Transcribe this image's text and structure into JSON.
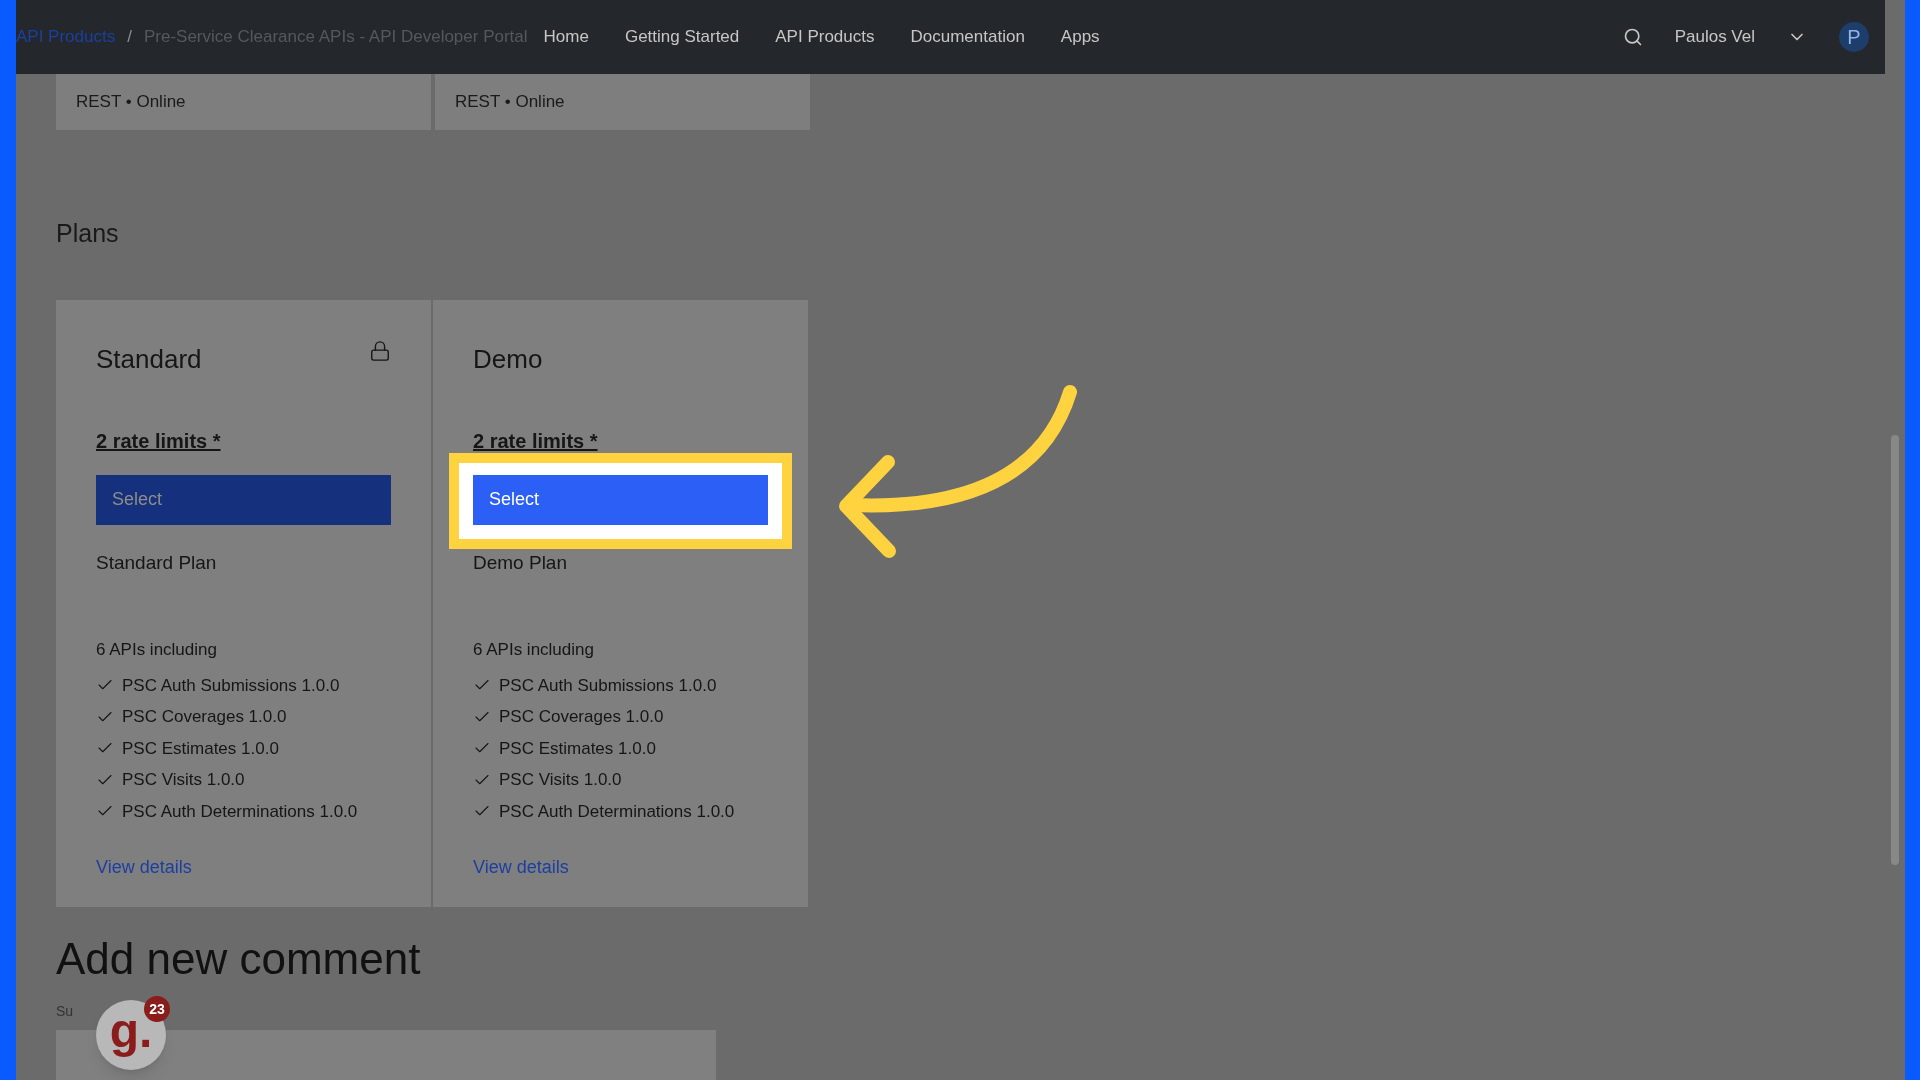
{
  "header": {
    "breadcrumb": [
      {
        "label": "API Products",
        "kind": "link"
      },
      {
        "label": "Pre-Service Clearance APIs - API Developer Portal",
        "kind": "current"
      }
    ],
    "separator": "/",
    "nav": [
      "Home",
      "Getting Started",
      "API Products",
      "Documentation",
      "Apps"
    ],
    "user": "Paulos Vel",
    "avatar": "P"
  },
  "api_cards": [
    "REST • Online",
    "REST • Online"
  ],
  "plans": {
    "title": "Plans",
    "items": [
      {
        "name": "Standard",
        "locked": true,
        "rate_limits": "2 rate limits *",
        "button": "Select",
        "disabled": true,
        "highlighted": false,
        "description": "Standard Plan",
        "apis_heading": "6 APIs including",
        "apis": [
          "PSC Auth Submissions 1.0.0",
          "PSC Coverages 1.0.0",
          "PSC Estimates 1.0.0",
          "PSC Visits 1.0.0",
          "PSC Auth Determinations 1.0.0"
        ],
        "link": "View details"
      },
      {
        "name": "Demo",
        "locked": false,
        "rate_limits": "2 rate limits *",
        "button": "Select",
        "disabled": false,
        "highlighted": true,
        "description": "Demo Plan",
        "apis_heading": "6 APIs including",
        "apis": [
          "PSC Auth Submissions 1.0.0",
          "PSC Coverages 1.0.0",
          "PSC Estimates 1.0.0",
          "PSC Visits 1.0.0",
          "PSC Auth Determinations 1.0.0"
        ],
        "link": "View details"
      }
    ]
  },
  "comment": {
    "heading": "Add new comment",
    "subject_label": "Su"
  },
  "badge": {
    "count": "23",
    "letter": "g."
  }
}
